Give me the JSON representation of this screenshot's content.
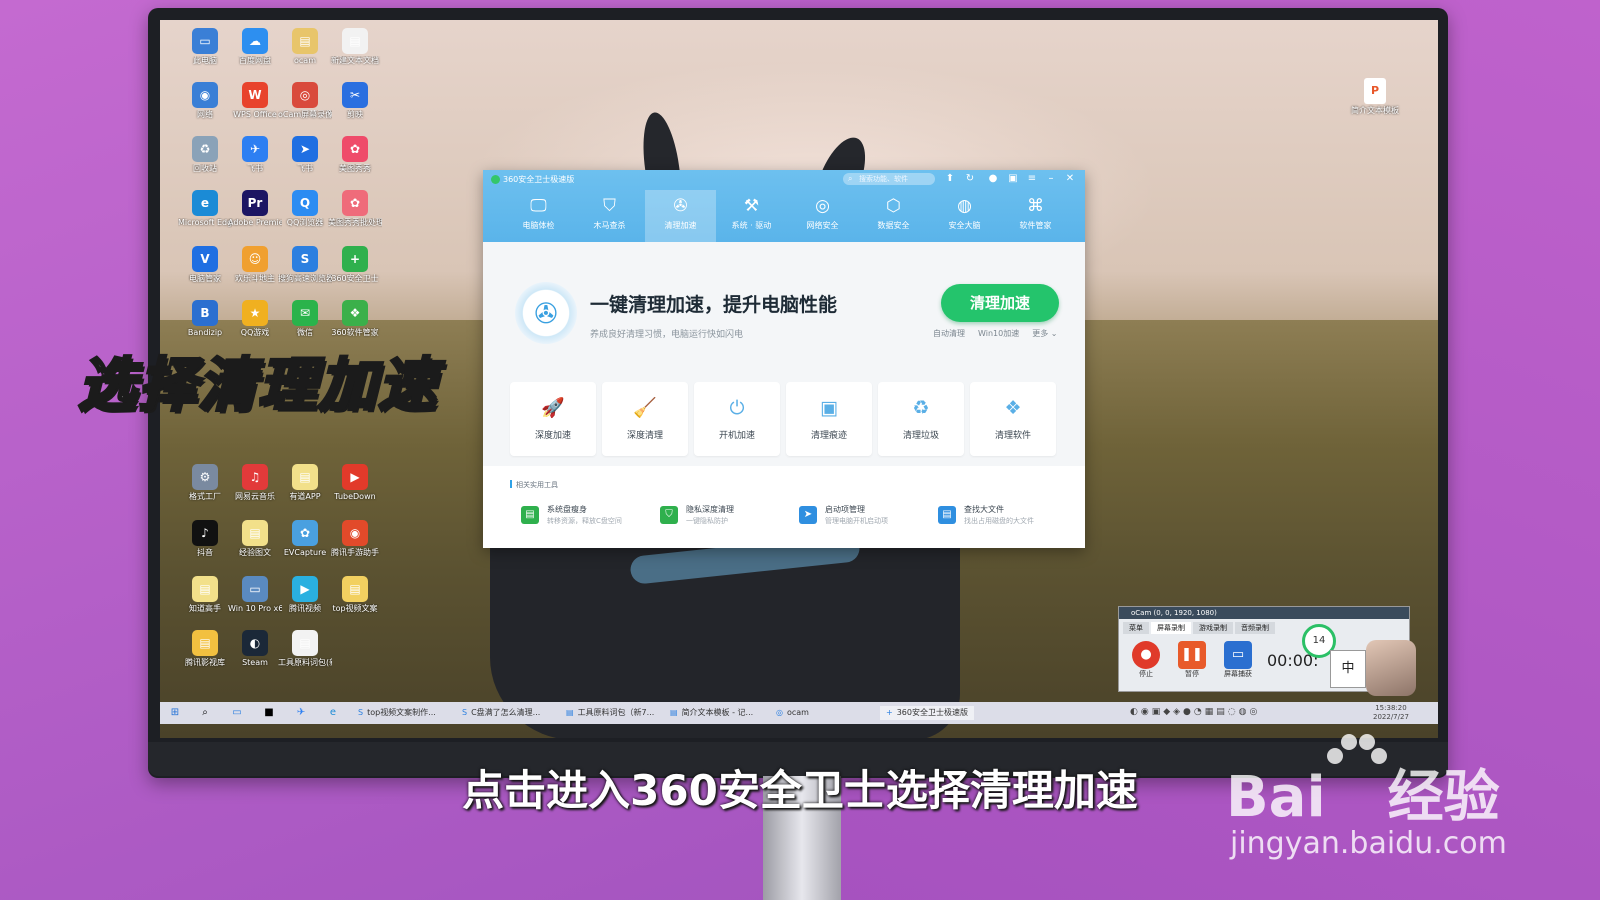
{
  "desktop": {
    "icons": [
      {
        "label": "此电脑",
        "glyph": "▭",
        "color": "#3a7fd6"
      },
      {
        "label": "百度网盘",
        "glyph": "☁",
        "color": "#2d8ff0"
      },
      {
        "label": "ocam",
        "glyph": "▤",
        "color": "#e8c56a"
      },
      {
        "label": "新建文本文档",
        "glyph": "▤",
        "color": "#f2f2f2"
      },
      {
        "label": "网络",
        "glyph": "◉",
        "color": "#3a7fd6"
      },
      {
        "label": "WPS Office",
        "glyph": "W",
        "color": "#e8432c"
      },
      {
        "label": "oCam屏幕录像",
        "glyph": "◎",
        "color": "#d94a3c"
      },
      {
        "label": "剪映",
        "glyph": "✂",
        "color": "#2a6fe0"
      },
      {
        "label": "回收站",
        "glyph": "♻",
        "color": "#8aa2b8"
      },
      {
        "label": "飞书",
        "glyph": "✈",
        "color": "#2d7ff2"
      },
      {
        "label": "飞书",
        "glyph": "➤",
        "color": "#1f6fe2"
      },
      {
        "label": "美图秀秀",
        "glyph": "✿",
        "color": "#ef4b6a"
      },
      {
        "label": "Microsoft Edge",
        "glyph": "e",
        "color": "#1b8bd6"
      },
      {
        "label": "Adobe Premiere",
        "glyph": "Pr",
        "color": "#1c1563"
      },
      {
        "label": "QQ浏览器",
        "glyph": "Q",
        "color": "#2b8cf2"
      },
      {
        "label": "美图秀秀批处理",
        "glyph": "✿",
        "color": "#ef6b7a"
      },
      {
        "label": "电脑管家",
        "glyph": "V",
        "color": "#1f6fe2"
      },
      {
        "label": "欢乐斗地主",
        "glyph": "☺",
        "color": "#f0a030"
      },
      {
        "label": "搜狗高速浏览器",
        "glyph": "S",
        "color": "#2b7fe0"
      },
      {
        "label": "360安全卫士",
        "glyph": "+",
        "color": "#2fb04d"
      },
      {
        "label": "Bandizip",
        "glyph": "B",
        "color": "#2b6fd0"
      },
      {
        "label": "QQ游戏",
        "glyph": "★",
        "color": "#f0b020"
      },
      {
        "label": "微信",
        "glyph": "✉",
        "color": "#2ab34b"
      },
      {
        "label": "360软件管家",
        "glyph": "❖",
        "color": "#3bb04a"
      },
      {
        "label": "格式工厂",
        "glyph": "⚙",
        "color": "#7a8aa0"
      },
      {
        "label": "网易云音乐",
        "glyph": "♫",
        "color": "#e23a3a"
      },
      {
        "label": "有道APP",
        "glyph": "▤",
        "color": "#f2e08a"
      },
      {
        "label": "TubeDown",
        "glyph": "▶",
        "color": "#e23a2a"
      },
      {
        "label": "抖音",
        "glyph": "♪",
        "color": "#111111"
      },
      {
        "label": "经验图文",
        "glyph": "▤",
        "color": "#f2e08a"
      },
      {
        "label": "EVCapture",
        "glyph": "✿",
        "color": "#4aa0e0"
      },
      {
        "label": "腾讯手游助手",
        "glyph": "◉",
        "color": "#e24a2a"
      },
      {
        "label": "知道高手",
        "glyph": "▤",
        "color": "#f2e08a"
      },
      {
        "label": "Win 10 Pro x64 (C)",
        "glyph": "▭",
        "color": "#5a8ac0"
      },
      {
        "label": "腾讯视频",
        "glyph": "▶",
        "color": "#2ab0e0"
      },
      {
        "label": "top视频文案",
        "glyph": "▤",
        "color": "#f2d060"
      },
      {
        "label": "腾讯影视库",
        "glyph": "▤",
        "color": "#f2c040"
      },
      {
        "label": "Steam",
        "glyph": "◐",
        "color": "#1b2838"
      },
      {
        "label": "工具原料词包(新7.1)",
        "glyph": "▤",
        "color": "#f2f2f2"
      }
    ],
    "right_icon": {
      "label": "简介文本模板",
      "glyph": "P"
    }
  },
  "win360": {
    "title": "360安全卫士极速版",
    "search_placeholder": "搜索功能、软件",
    "tabs": [
      {
        "label": "电脑体检",
        "glyph": "🖵"
      },
      {
        "label": "木马查杀",
        "glyph": "⛉"
      },
      {
        "label": "清理加速",
        "glyph": "✇"
      },
      {
        "label": "系统 · 驱动",
        "glyph": "⚒"
      },
      {
        "label": "网络安全",
        "glyph": "◎"
      },
      {
        "label": "数据安全",
        "glyph": "⬡"
      },
      {
        "label": "安全大脑",
        "glyph": "◍"
      },
      {
        "label": "软件管家",
        "glyph": "⌘"
      }
    ],
    "active_tab": 2,
    "hero_title": "一键清理加速，提升电脑性能",
    "hero_subtitle": "养成良好清理习惯，电脑运行快如闪电",
    "clean_button": "清理加速",
    "sublinks": [
      "自动清理",
      "Win10加速",
      "更多 ⌄"
    ],
    "cards": [
      {
        "label": "深度加速",
        "glyph": "🚀"
      },
      {
        "label": "深度清理",
        "glyph": "🧹"
      },
      {
        "label": "开机加速",
        "glyph": "⏻"
      },
      {
        "label": "清理痕迹",
        "glyph": "▣"
      },
      {
        "label": "清理垃圾",
        "glyph": "♻"
      },
      {
        "label": "清理软件",
        "glyph": "❖"
      }
    ],
    "tools_header": "相关实用工具",
    "tools": [
      {
        "title": "系统盘瘦身",
        "desc": "转移资源，释放C盘空间",
        "color": "#2fb04d",
        "glyph": "▤"
      },
      {
        "title": "隐私深度清理",
        "desc": "一键隐私防护",
        "color": "#2fb04d",
        "glyph": "⛉"
      },
      {
        "title": "启动项管理",
        "desc": "管理电脑开机启动项",
        "color": "#2f8fe0",
        "glyph": "➤"
      },
      {
        "title": "查找大文件",
        "desc": "找出占用磁盘的大文件",
        "color": "#2f8fe0",
        "glyph": "▤"
      }
    ]
  },
  "taskbar": {
    "items": [
      {
        "label": "top视频文案制作...",
        "glyph": "S"
      },
      {
        "label": "C盘满了怎么清理...",
        "glyph": "S"
      },
      {
        "label": "工具原料词包（新7...",
        "glyph": "▤"
      },
      {
        "label": "简介文本模板 - 记...",
        "glyph": "▤"
      },
      {
        "label": "ocam",
        "glyph": "◎"
      },
      {
        "label": "360安全卫士极速版",
        "glyph": "+"
      }
    ],
    "clock_time": "15:38:20",
    "clock_date": "2022/7/27"
  },
  "ocam": {
    "title": "oCam (0, 0, 1920, 1080)",
    "tabs": [
      "菜单",
      "屏幕录制",
      "游戏录制",
      "音频录制"
    ],
    "buttons": [
      "停止",
      "暂停",
      "屏幕捕获"
    ],
    "time": "00:00:",
    "ring_value": "14",
    "ime": "中"
  },
  "overlay": {
    "left_caption": "选择清理加速",
    "subtitle": "点击进入360安全卫士选择清理加速",
    "watermark_main": "Bai",
    "watermark_tail": "经验",
    "watermark_url": "jingyan.baidu.com"
  }
}
